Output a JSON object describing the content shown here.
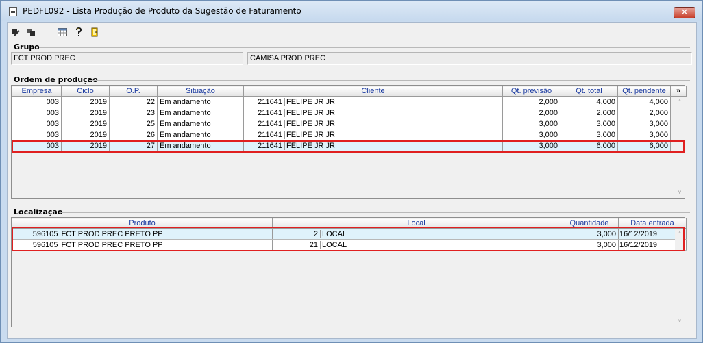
{
  "window": {
    "title": "PEDFL092 - Lista Produção de Produto da Sugestão de Faturamento",
    "close_label": "✕"
  },
  "toolbar": {
    "icons": [
      "exit-icon",
      "export-icon",
      "calendar-grid-icon",
      "help-icon",
      "door-icon"
    ]
  },
  "grupo": {
    "title": "Grupo",
    "code": "FCT PROD PREC",
    "description": "CAMISA PROD PREC"
  },
  "ordem": {
    "title": "Ordem de produção",
    "columns": [
      "Empresa",
      "Ciclo",
      "O.P.",
      "Situação",
      "Cliente",
      "Qt. previsão",
      "Qt. total",
      "Qt. pendente"
    ],
    "more_label": "»",
    "rows": [
      {
        "empresa": "003",
        "ciclo": "2019",
        "op": "22",
        "situacao": "Em andamento",
        "cliente_cod": "211641",
        "cliente_nome": "FELIPE JR JR",
        "qt_previsao": "2,000",
        "qt_total": "4,000",
        "qt_pendente": "4,000"
      },
      {
        "empresa": "003",
        "ciclo": "2019",
        "op": "23",
        "situacao": "Em andamento",
        "cliente_cod": "211641",
        "cliente_nome": "FELIPE JR JR",
        "qt_previsao": "2,000",
        "qt_total": "2,000",
        "qt_pendente": "2,000"
      },
      {
        "empresa": "003",
        "ciclo": "2019",
        "op": "25",
        "situacao": "Em andamento",
        "cliente_cod": "211641",
        "cliente_nome": "FELIPE JR JR",
        "qt_previsao": "3,000",
        "qt_total": "3,000",
        "qt_pendente": "3,000"
      },
      {
        "empresa": "003",
        "ciclo": "2019",
        "op": "26",
        "situacao": "Em andamento",
        "cliente_cod": "211641",
        "cliente_nome": "FELIPE JR JR",
        "qt_previsao": "3,000",
        "qt_total": "3,000",
        "qt_pendente": "3,000"
      },
      {
        "empresa": "003",
        "ciclo": "2019",
        "op": "27",
        "situacao": "Em andamento",
        "cliente_cod": "211641",
        "cliente_nome": "FELIPE JR JR",
        "qt_previsao": "3,000",
        "qt_total": "6,000",
        "qt_pendente": "6,000"
      }
    ]
  },
  "localizacao": {
    "title": "Localização",
    "columns": [
      "Produto",
      "Local",
      "Quantidade",
      "Data entrada"
    ],
    "rows": [
      {
        "produto_cod": "596105",
        "produto_nome": "FCT PROD PREC PRETO PP",
        "local_cod": "2",
        "local_nome": "LOCAL",
        "quantidade": "3,000",
        "data_entrada": "16/12/2019"
      },
      {
        "produto_cod": "596105",
        "produto_nome": "FCT PROD PREC PRETO PP",
        "local_cod": "21",
        "local_nome": "LOCAL",
        "quantidade": "3,000",
        "data_entrada": "16/12/2019"
      }
    ]
  },
  "scroll": {
    "up": "^",
    "down": "v"
  },
  "colors": {
    "highlight": "#e02020",
    "selected_row": "#dff2fb",
    "header_text": "#1a3aa0"
  }
}
